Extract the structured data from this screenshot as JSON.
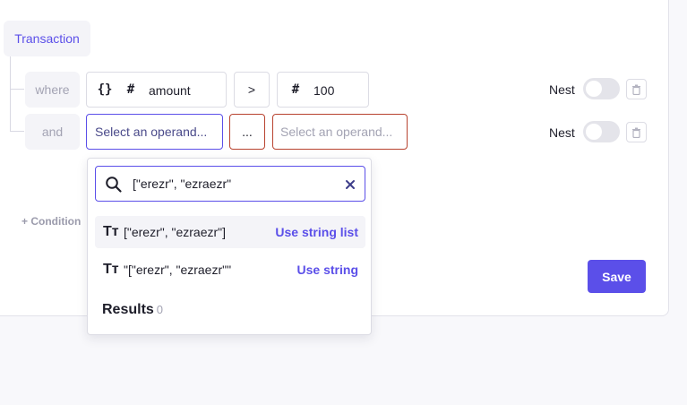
{
  "root_label": "Transaction",
  "conditions": [
    {
      "conjunction": "where",
      "left": {
        "icons": [
          "{}",
          "#"
        ],
        "value": "amount"
      },
      "operator": ">",
      "right": {
        "icon": "#",
        "value": "100"
      },
      "nest_label": "Nest",
      "nest_enabled": false
    },
    {
      "conjunction": "and",
      "left_placeholder": "Select an operand...",
      "operator": "...",
      "right_placeholder": "Select an operand...",
      "nest_label": "Nest",
      "nest_enabled": false
    }
  ],
  "add_condition_label": "+ Condition",
  "save_label": "Save",
  "dropdown": {
    "search_value": "[\"erezr\", \"ezraezr\"",
    "options": [
      {
        "icon": "Tт",
        "label": "[\"erezr\", \"ezraezr\"]",
        "action": "Use string list"
      },
      {
        "icon": "Tт",
        "label": "\"[\"erezr\", \"ezraezr\"\"",
        "action": "Use string"
      }
    ],
    "results_label": "Results",
    "results_count": "0"
  },
  "colors": {
    "accent": "#5b4fe9",
    "error": "#b8432f"
  }
}
